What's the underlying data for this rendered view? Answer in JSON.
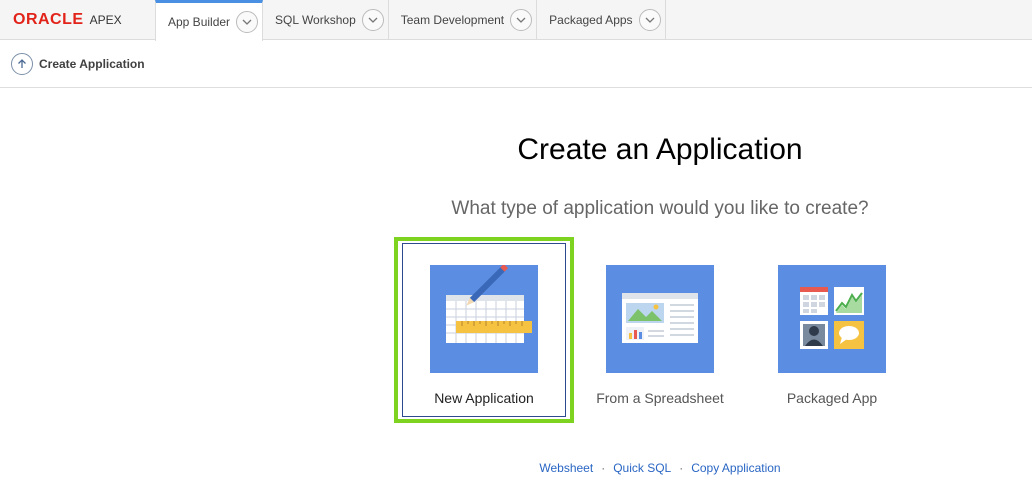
{
  "brand": {
    "oracle": "ORACLE",
    "product": "APEX"
  },
  "tabs": [
    {
      "label": "App Builder"
    },
    {
      "label": "SQL Workshop"
    },
    {
      "label": "Team Development"
    },
    {
      "label": "Packaged Apps"
    }
  ],
  "breadcrumb": {
    "label": "Create Application"
  },
  "main": {
    "title": "Create an Application",
    "question": "What type of application would you like to create?",
    "choices": [
      {
        "label": "New Application"
      },
      {
        "label": "From a Spreadsheet"
      },
      {
        "label": "Packaged App"
      }
    ],
    "links": [
      {
        "label": "Websheet"
      },
      {
        "label": "Quick SQL"
      },
      {
        "label": "Copy Application"
      }
    ]
  },
  "colors": {
    "accent": "#4a90e2",
    "tile": "#5b8de2",
    "selection": "#7ed321",
    "brand_red": "#e2231a",
    "link": "#2a66c4"
  }
}
